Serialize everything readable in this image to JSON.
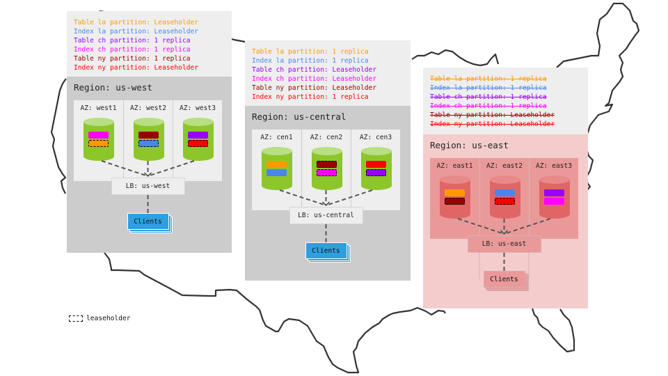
{
  "legend_key": {
    "label": "leaseholder",
    "icon": "dashed-box-icon"
  },
  "partition_colors": {
    "table_la": "#ff9900",
    "index_la": "#4a86e8",
    "table_ch": "#9900ff",
    "index_ch": "#ff00ff",
    "table_ny": "#990000",
    "index_ny": "#ff0000"
  },
  "regions": [
    {
      "id": "us-west",
      "theme": "green",
      "struck": false,
      "partitions": [
        {
          "key": "table_la",
          "text": "Table la partition: Leaseholder"
        },
        {
          "key": "index_la",
          "text": "Index la partition: Leaseholder"
        },
        {
          "key": "table_ch",
          "text": "Table ch partition: 1 replica"
        },
        {
          "key": "index_ch",
          "text": "Index ch partition: 1 replica"
        },
        {
          "key": "table_ny",
          "text": "Table ny partition: 1 replica"
        },
        {
          "key": "index_ny",
          "text": "Index ny partition: Leaseholder"
        }
      ],
      "title": "Region: us-west",
      "azs": [
        {
          "label": "AZ: west1",
          "chips": [
            {
              "key": "index_ch",
              "leaseholder": false
            },
            {
              "key": "table_la",
              "leaseholder": true
            }
          ]
        },
        {
          "label": "AZ: west2",
          "chips": [
            {
              "key": "table_ny",
              "leaseholder": false
            },
            {
              "key": "index_la",
              "leaseholder": true
            }
          ]
        },
        {
          "label": "AZ: west3",
          "chips": [
            {
              "key": "table_ch",
              "leaseholder": false
            },
            {
              "key": "index_ny",
              "leaseholder": true
            }
          ]
        }
      ],
      "lb": "LB: us-west",
      "clients": "Clients"
    },
    {
      "id": "us-central",
      "theme": "green",
      "struck": false,
      "partitions": [
        {
          "key": "table_la",
          "text": "Table la partition: 1 replica"
        },
        {
          "key": "index_la",
          "text": "Index la partition: 1 replica"
        },
        {
          "key": "table_ch",
          "text": "Table ch partition: Leaseholder"
        },
        {
          "key": "index_ch",
          "text": "Index ch partition: Leaseholder"
        },
        {
          "key": "table_ny",
          "text": "Table ny partition: Leaseholder"
        },
        {
          "key": "index_ny",
          "text": "Index ny partition: 1 replica"
        }
      ],
      "title": "Region: us-central",
      "azs": [
        {
          "label": "AZ: cen1",
          "chips": [
            {
              "key": "table_la",
              "leaseholder": false
            },
            {
              "key": "index_la",
              "leaseholder": false
            }
          ]
        },
        {
          "label": "AZ: cen2",
          "chips": [
            {
              "key": "table_ny",
              "leaseholder": true
            },
            {
              "key": "index_ch",
              "leaseholder": true
            }
          ]
        },
        {
          "label": "AZ: cen3",
          "chips": [
            {
              "key": "index_ny",
              "leaseholder": false
            },
            {
              "key": "table_ch",
              "leaseholder": true
            }
          ]
        }
      ],
      "lb": "LB: us-central",
      "clients": "Clients"
    },
    {
      "id": "us-east",
      "theme": "red",
      "struck": true,
      "partitions": [
        {
          "key": "table_la",
          "text": "Table la partition: 1 replica"
        },
        {
          "key": "index_la",
          "text": "Index la partition: 1 replica"
        },
        {
          "key": "table_ch",
          "text": "Table ch partition: 1 replica"
        },
        {
          "key": "index_ch",
          "text": "Index ch partition: 1 replica"
        },
        {
          "key": "table_ny",
          "text": "Table ny partition: Leaseholder"
        },
        {
          "key": "index_ny",
          "text": "Index ny partition: Leaseholder"
        }
      ],
      "title": "Region: us-east",
      "azs": [
        {
          "label": "AZ: east1",
          "chips": [
            {
              "key": "table_la",
              "leaseholder": false
            },
            {
              "key": "table_ny",
              "leaseholder": true
            }
          ]
        },
        {
          "label": "AZ: east2",
          "chips": [
            {
              "key": "index_la",
              "leaseholder": false
            },
            {
              "key": "index_ny",
              "leaseholder": true
            }
          ]
        },
        {
          "label": "AZ: east3",
          "chips": [
            {
              "key": "table_ch",
              "leaseholder": false
            },
            {
              "key": "index_ch",
              "leaseholder": false
            }
          ]
        }
      ],
      "lb": "LB: us-east",
      "clients": "Clients"
    }
  ]
}
